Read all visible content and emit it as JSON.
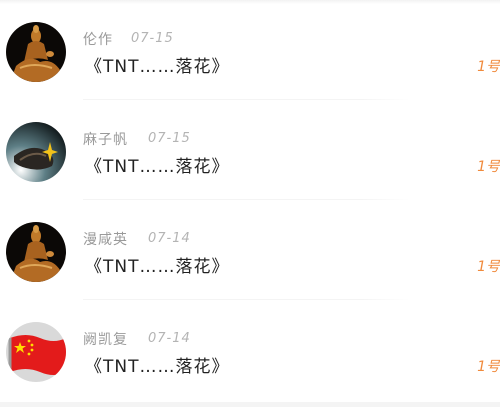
{
  "items": [
    {
      "user": "伦作",
      "date": "07-15",
      "song": "《TNT……落花》",
      "rank": "1号",
      "avatar": "buddha-statue"
    },
    {
      "user": "麻子帆",
      "date": "07-15",
      "song": "《TNT……落花》",
      "rank": "1号",
      "avatar": "buddha-hand"
    },
    {
      "user": "漫咸英",
      "date": "07-14",
      "song": "《TNT……落花》",
      "rank": "1号",
      "avatar": "buddha-statue"
    },
    {
      "user": "阙凯复",
      "date": "07-14",
      "song": "《TNT……落花》",
      "rank": "1号",
      "avatar": "china-flag"
    }
  ]
}
